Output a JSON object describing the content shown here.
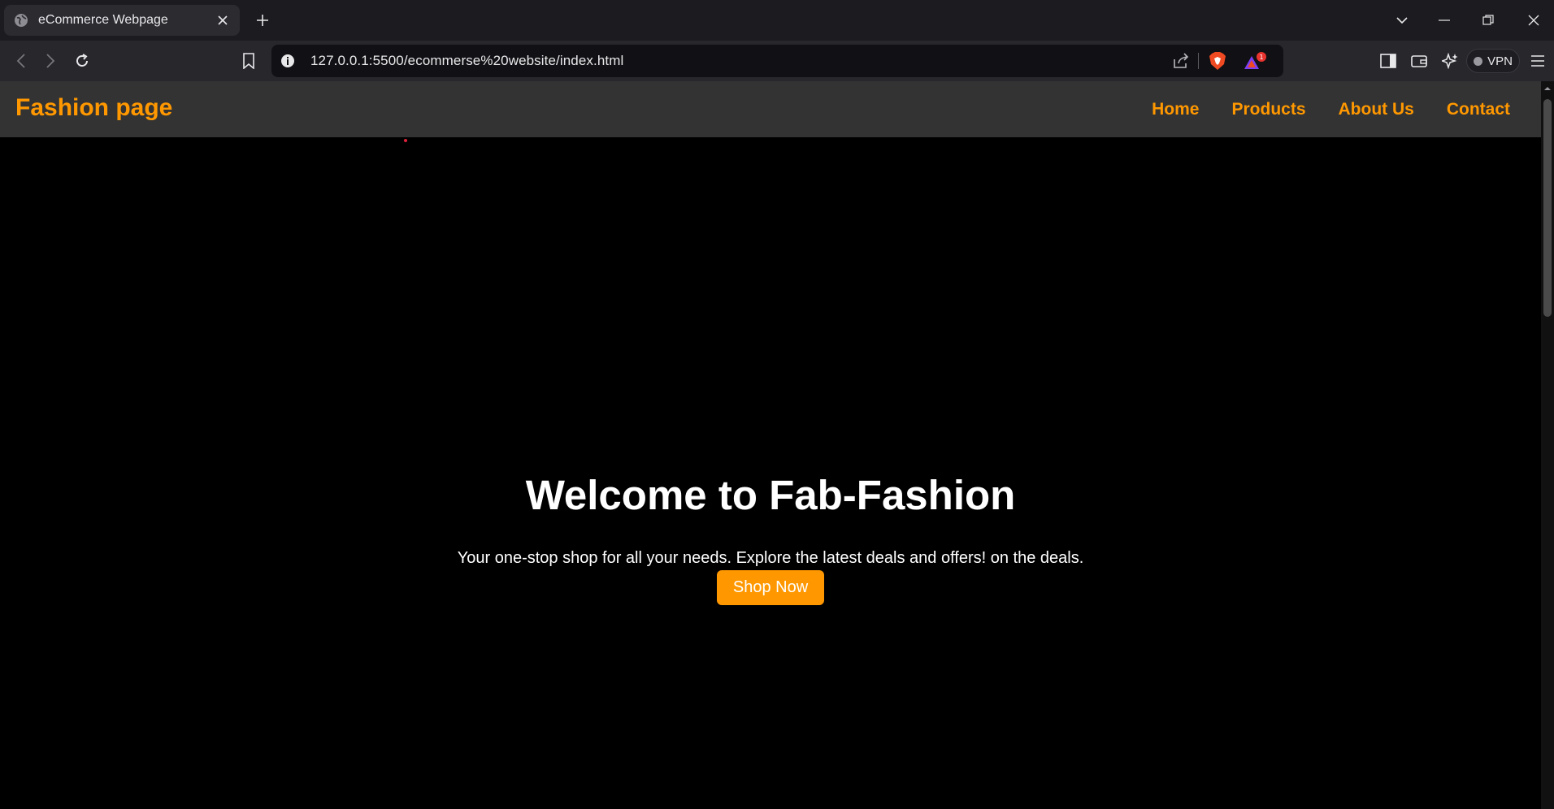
{
  "browser": {
    "tab": {
      "title": "eCommerce Webpage",
      "favicon": "globe-icon"
    },
    "url": "127.0.0.1:5500/ecommerse%20website/index.html",
    "vpn_label": "VPN",
    "rewards_badge": "1"
  },
  "site": {
    "logo": "Fashion page",
    "nav": [
      "Home",
      "Products",
      "About Us",
      "Contact"
    ],
    "hero": {
      "title": "Welcome to Fab-Fashion",
      "subtitle": "Your one-stop shop for all your needs. Explore the latest deals and offers! on the deals.",
      "cta": "Shop Now"
    }
  },
  "colors": {
    "accent": "#ff9800",
    "header_bg": "#333333",
    "page_bg": "#000000",
    "text": "#ffffff"
  }
}
